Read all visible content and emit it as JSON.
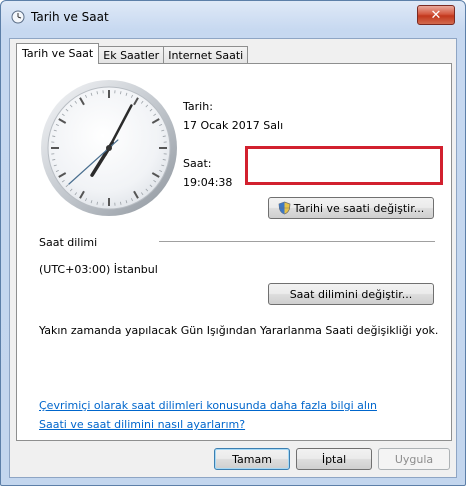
{
  "window": {
    "title": "Tarih ve Saat",
    "close_glyph": "✕"
  },
  "tabs": [
    {
      "label": "Tarih ve Saat",
      "active": true
    },
    {
      "label": "Ek Saatler",
      "active": false
    },
    {
      "label": "Internet Saati",
      "active": false
    }
  ],
  "datetime": {
    "date_label": "Tarih:",
    "date_value": "17 Ocak 2017 Salı",
    "time_label": "Saat:",
    "time_value": "19:04:38",
    "change_button": "Tarihi ve saati değiştir..."
  },
  "timezone": {
    "section_label": "Saat dilimi",
    "value": "(UTC+03:00) İstanbul",
    "change_button": "Saat dilimini değiştir..."
  },
  "dst_notice": "Yakın zamanda yapılacak Gün Işığından Yararlanma Saati değişikliği yok.",
  "links": {
    "timezones_online": "Çevrimiçi olarak saat dilimleri konusunda daha fazla bilgi alın",
    "how_to_set": "Saati ve saat dilimini nasıl ayarlarım?"
  },
  "footer": {
    "ok": "Tamam",
    "cancel": "İptal",
    "apply": "Uygula"
  },
  "clock": {
    "hour": 19,
    "minute": 4,
    "second": 38
  },
  "colors": {
    "highlight_border": "#d2202e",
    "link": "#0066cc"
  }
}
